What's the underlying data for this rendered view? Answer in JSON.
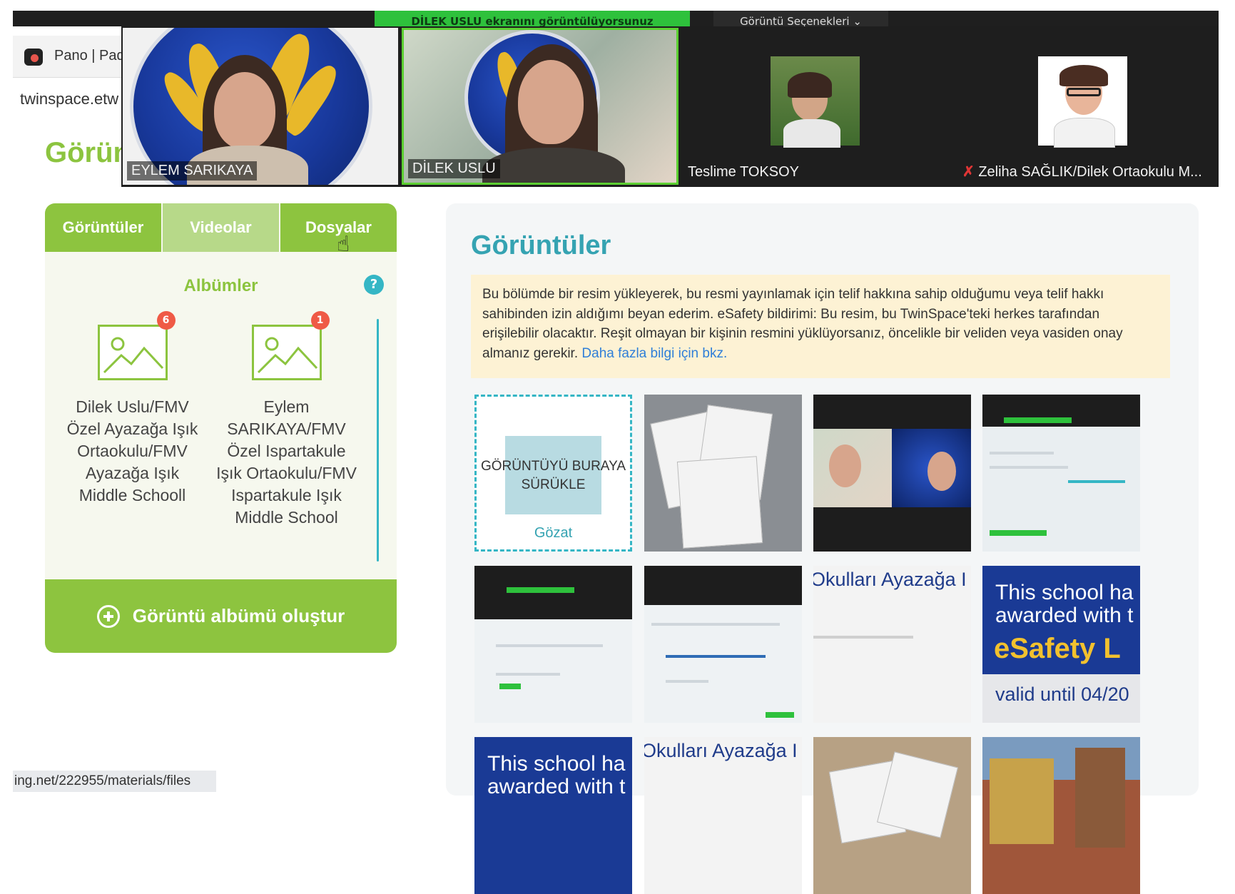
{
  "zoom": {
    "share_banner": "DİLEK USLU ekranını görüntülüyorsunuz",
    "view_options": "Görüntü Seçenekleri ⌄",
    "participants": [
      {
        "name": "EYLEM SARIKAYA",
        "active": false
      },
      {
        "name": "DİLEK USLU",
        "active": true
      },
      {
        "name": "Teslime TOKSOY",
        "active": false
      },
      {
        "name": "Zeliha SAĞLIK/Dilek Ortaokulu M...",
        "muted": true
      }
    ]
  },
  "browser": {
    "tab_title": "Pano | Pad",
    "address": "twinspace.etw",
    "status_url": "ing.net/222955/materials/files"
  },
  "page": {
    "heading_partial": "Görün"
  },
  "left_panel": {
    "tabs": [
      {
        "label": "Görüntüler",
        "selected": true
      },
      {
        "label": "Videolar",
        "selected": false
      },
      {
        "label": "Dosyalar",
        "selected": false
      }
    ],
    "albums_title": "Albümler",
    "help": "?",
    "albums": [
      {
        "badge": "6",
        "name": "Dilek Uslu/FMV Özel Ayazağa Işık Ortaokulu/FMV Ayazağa Işık Middle Schooll"
      },
      {
        "badge": "1",
        "name": "Eylem SARIKAYA/FMV Özel Ispartakule Işık Ortaokulu/FMV Ispartakule Işık Middle School"
      }
    ],
    "create_album": "Görüntü albümü oluştur"
  },
  "gallery": {
    "title": "Görüntüler",
    "notice": "Bu bölümde bir resim yükleyerek, bu resmi yayınlamak için telif hakkına sahip olduğumu veya telif hakkı sahibinden izin aldığımı beyan ederim. eSafety bildirimi: Bu resim, bu TwinSpace'teki herkes tarafından erişilebilir olacaktır. Reşit olmayan bir kişinin resmini yüklüyorsanız, öncelikle bir veliden veya vasiden onay almanız gerekir. ",
    "notice_link": "Daha fazla bilgi için bkz.",
    "drop_zone_text": "GÖRÜNTÜYÜ BURAYA SÜRÜKLE",
    "browse": "Gözat",
    "thumb_texts": {
      "ayazaga": "Okulları Ayazağa I",
      "esafety_line1": "This school ha",
      "esafety_line2": "awarded with t",
      "esafety_line3": "eSafety L",
      "esafety_line4": "valid until 04/20",
      "esafety_b_line1": "This school ha",
      "esafety_b_line2": "awarded with t",
      "ayazaga_b": "Okulları Ayazağa I"
    }
  },
  "colors": {
    "green": "#8dc43f",
    "teal": "#35a3b2",
    "notice_bg": "#fdf2d4",
    "zoom_active": "#5ccf32"
  }
}
